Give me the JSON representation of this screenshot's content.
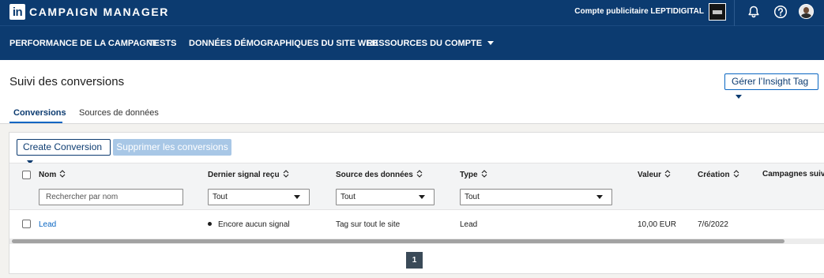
{
  "topbar": {
    "logo_text": "in",
    "app_title": "CAMPAIGN MANAGER",
    "account_label": "Compte publicitaire LEPTIDIGITAL",
    "icons": [
      "bell-icon",
      "help-icon",
      "avatar"
    ],
    "background_color": "#0c3b70"
  },
  "nav": {
    "items": [
      {
        "label": "PERFORMANCE DE LA CAMPAGNE"
      },
      {
        "label": "TESTS"
      },
      {
        "label": "DONNÉES DÉMOGRAPHIQUES DU SITE WEB"
      },
      {
        "label": "RESSOURCES DU COMPTE"
      }
    ]
  },
  "page": {
    "title": "Suivi des conversions",
    "insight_button": "Gérer l’Insight Tag"
  },
  "tabs": [
    {
      "label": "Conversions",
      "active": true
    },
    {
      "label": "Sources de données",
      "active": false
    }
  ],
  "toolbar": {
    "create_label": "Create Conversion",
    "delete_label": "Supprimer les conversions"
  },
  "table": {
    "columns": [
      {
        "label": "Nom",
        "sortable": true
      },
      {
        "label": "Dernier signal reçu",
        "sortable": true
      },
      {
        "label": "Source des données",
        "sortable": true
      },
      {
        "label": "Type",
        "sortable": true
      },
      {
        "label": "Valeur",
        "sortable": true
      },
      {
        "label": "Création",
        "sortable": true
      },
      {
        "label": "Campagnes suivies",
        "sortable": false
      }
    ],
    "filters": {
      "name_placeholder": "Rechercher par nom",
      "signal": "Tout",
      "source": "Tout",
      "type": "Tout"
    },
    "rows": [
      {
        "name": "Lead",
        "last_signal": "Encore aucun signal",
        "source": "Tag sur tout le site",
        "type": "Lead",
        "value": "10,00 EUR",
        "created": "7/6/2022"
      }
    ]
  },
  "pagination": {
    "current_page": "1"
  },
  "colors": {
    "brand_navy": "#0c3b70",
    "link_blue": "#0a66c2",
    "disabled_button": "#a8c7e6",
    "page_button": "#3a4a58"
  }
}
